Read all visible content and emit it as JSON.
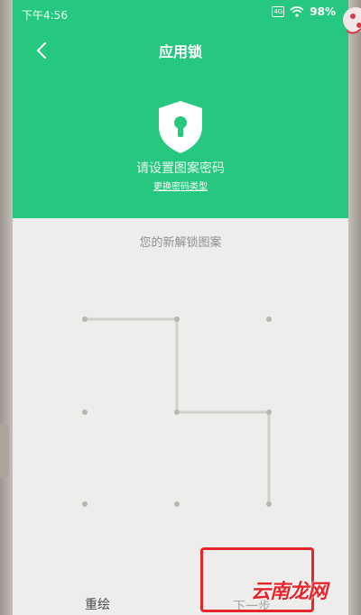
{
  "status_bar": {
    "time": "下午4:56",
    "sim_label": "4G",
    "battery": "98%"
  },
  "header": {
    "title": "应用锁",
    "back_icon": "chevron-left-icon",
    "lock_icon": "shield-lock-icon",
    "prompt": "请设置图案密码",
    "change_type_link": "更换密码类型"
  },
  "body": {
    "subtitle": "您的新解锁图案"
  },
  "pattern": {
    "rows": 3,
    "cols": 3,
    "path": [
      [
        0,
        0
      ],
      [
        1,
        0
      ],
      [
        1,
        1
      ],
      [
        2,
        1
      ],
      [
        2,
        2
      ]
    ]
  },
  "footer": {
    "reset_label": "重绘",
    "next_label": "下一步"
  },
  "watermark": {
    "text": "云南龙网"
  },
  "colors": {
    "header_green": "#26c77e",
    "background": "#ededeb",
    "highlight_red": "#e8242b"
  }
}
